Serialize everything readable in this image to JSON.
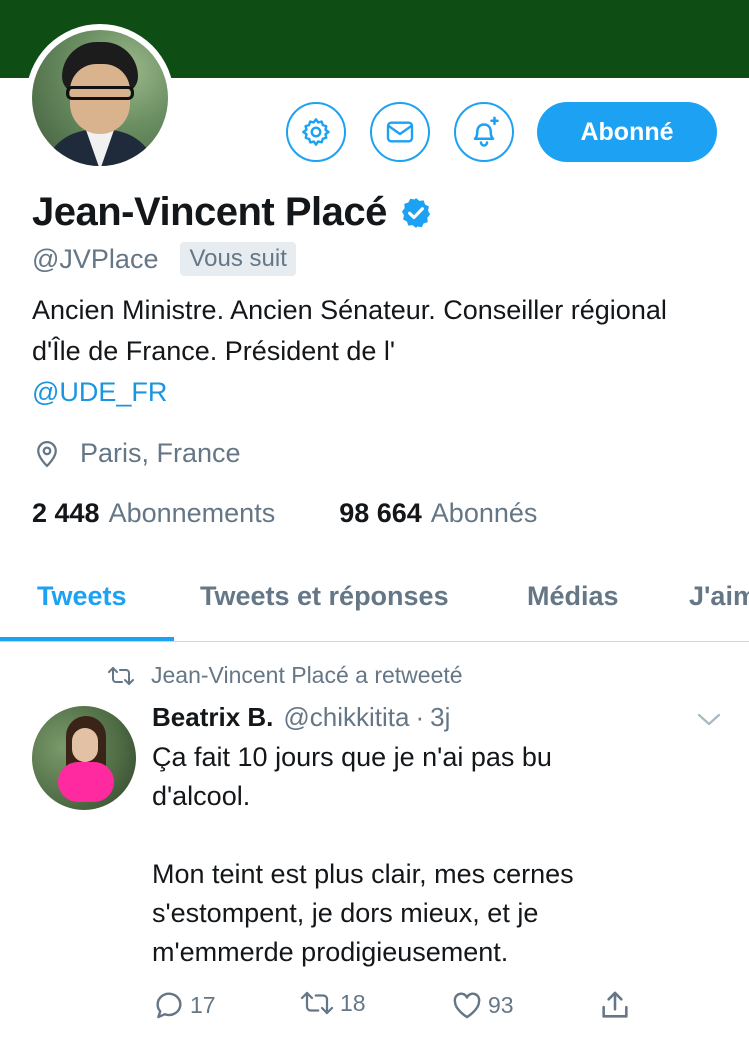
{
  "profile": {
    "name": "Jean-Vincent Placé",
    "handle": "@JVPlace",
    "follows_you": "Vous suit",
    "follow_button": "Abonné",
    "bio_text": "Ancien Ministre. Ancien Sénateur. Conseiller régional d'Île de France. Président de l'",
    "bio_mention": "@UDE_FR",
    "location": "Paris, France",
    "following_count": "2 448",
    "following_label": "Abonnements",
    "followers_count": "98 664",
    "followers_label": "Abonnés",
    "banner_color": "#0e4d13"
  },
  "tabs": [
    {
      "label": "Tweets",
      "active": true
    },
    {
      "label": "Tweets et réponses",
      "active": false
    },
    {
      "label": "Médias",
      "active": false
    },
    {
      "label": "J'aime",
      "active": false
    }
  ],
  "tweet": {
    "retweet_note": "Jean-Vincent Placé a retweeté",
    "author_name": "Beatrix B.",
    "author_handle": "@chikkitita",
    "separator": "·",
    "time": "3j",
    "text": "Ça fait 10 jours que je n'ai pas bu\nd'alcool.\n\nMon teint est plus clair, mes cernes\ns'estompent, je dors mieux, et je\nm'emmerde prodigieusement.",
    "replies": "17",
    "retweets": "18",
    "likes": "93"
  },
  "icons": {
    "settings": "gear-icon",
    "message": "envelope-icon",
    "notifications": "bell-plus-icon",
    "verified": "verified-badge-icon",
    "location": "map-pin-icon",
    "retweet": "retweet-icon",
    "chevron": "chevron-down-icon",
    "reply": "reply-icon",
    "like": "heart-icon",
    "share": "share-icon"
  },
  "colors": {
    "accent": "#1da1f2",
    "muted": "#657786",
    "text": "#14171a"
  }
}
